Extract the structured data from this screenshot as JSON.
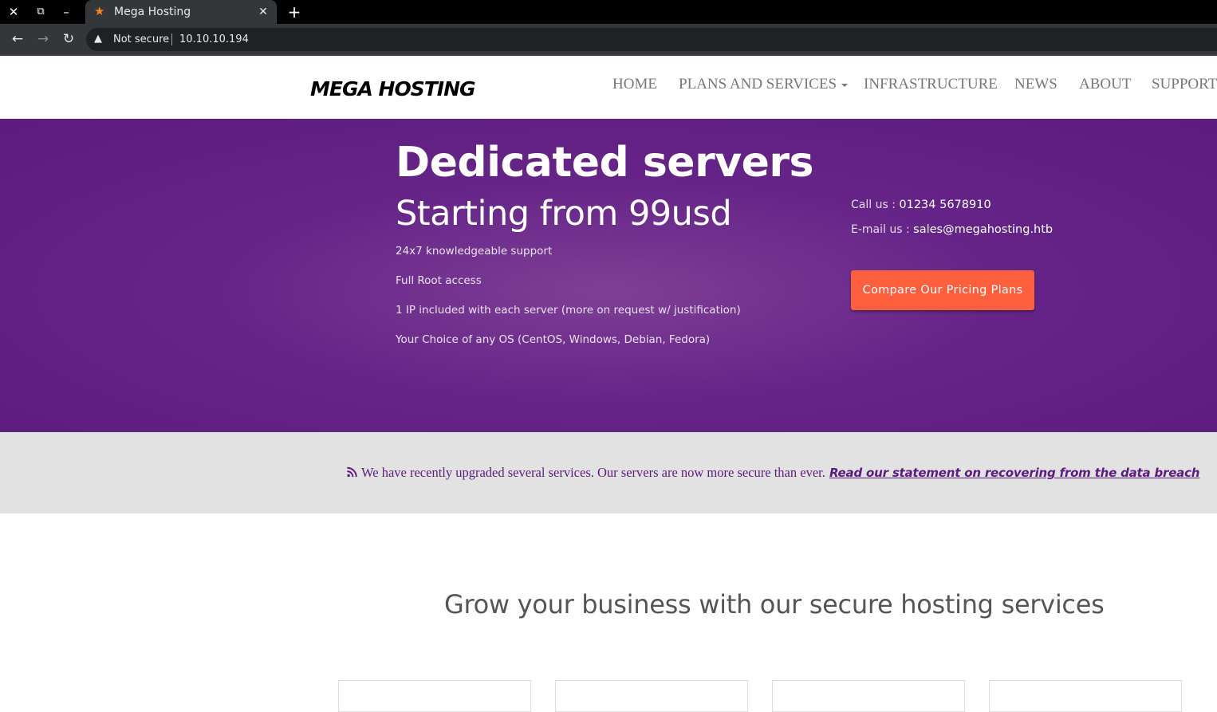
{
  "browser": {
    "window_controls": {
      "close_symbol": "✕",
      "restore_symbol": "⧉",
      "minimize_symbol": "–"
    },
    "tab": {
      "title": "Mega Hosting",
      "favicon_symbol": "★",
      "close_symbol": "✕"
    },
    "new_tab_symbol": "+",
    "nav": {
      "back_symbol": "←",
      "forward_symbol": "→",
      "reload_symbol": "↻"
    },
    "security_label": "Not secure",
    "warning_symbol": "▲",
    "url": "10.10.10.194"
  },
  "header": {
    "logo": "MEGA HOSTING",
    "nav": {
      "home": "HOME",
      "plans": "PLANS AND SERVICES",
      "infrastructure": "INFRASTRUCTURE",
      "news": "NEWS",
      "about": "ABOUT",
      "support": "SUPPORT"
    }
  },
  "hero": {
    "title": "Dedicated servers",
    "subtitle": "Starting from 99usd",
    "features": [
      "24x7 knowledgeable support",
      "Full Root access",
      "1 IP included with each server (more on request w/ justification)",
      "Your Choice of any OS (CentOS, Windows, Debian, Fedora)"
    ],
    "call_label": "Call us : ",
    "call_value": "01234 5678910",
    "email_label": "E-mail us : ",
    "email_value": "sales@megahosting.htb",
    "cta_label": "Compare Our Pricing Plans"
  },
  "notice": {
    "icon": "rss-icon",
    "text": "We have recently upgraded several services. Our servers are now more secure than ever.",
    "link": "Read our statement on recovering from the data breach"
  },
  "section": {
    "title": "Grow your business with our secure hosting services"
  },
  "colors": {
    "brand_purple": "#652587",
    "cta_orange": "#fe5f3f",
    "notice_bg": "#e2e2e2",
    "nav_gray": "#777777"
  }
}
